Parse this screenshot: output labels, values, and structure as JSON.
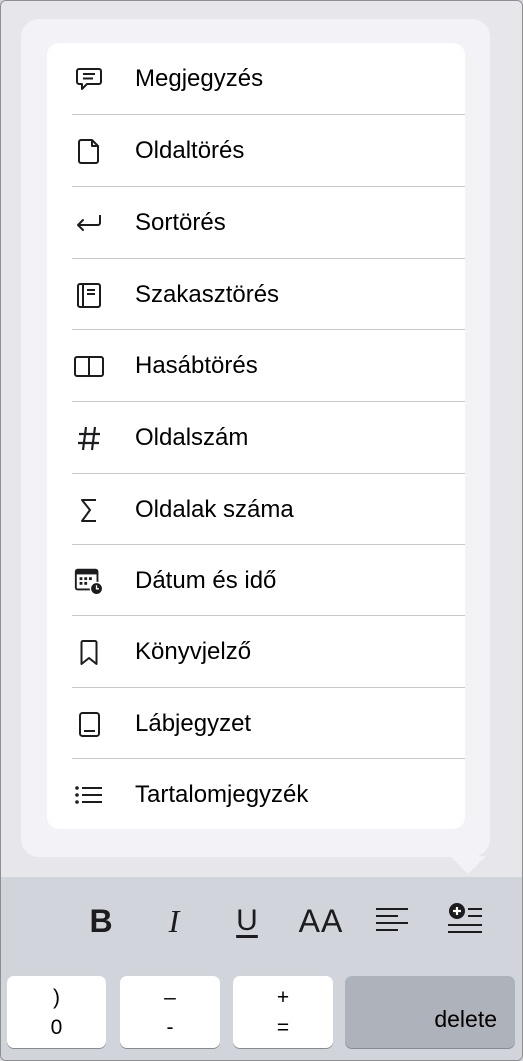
{
  "menu": {
    "items": [
      {
        "label": "Megjegyzés",
        "icon": "comment-icon"
      },
      {
        "label": "Oldaltörés",
        "icon": "page-break-icon"
      },
      {
        "label": "Sortörés",
        "icon": "line-break-icon"
      },
      {
        "label": "Szakasztörés",
        "icon": "section-break-icon"
      },
      {
        "label": "Hasábtörés",
        "icon": "column-break-icon"
      },
      {
        "label": "Oldalszám",
        "icon": "hash-icon"
      },
      {
        "label": "Oldalak száma",
        "icon": "sigma-icon"
      },
      {
        "label": "Dátum és idő",
        "icon": "calendar-clock-icon"
      },
      {
        "label": "Könyvjelző",
        "icon": "bookmark-icon"
      },
      {
        "label": "Lábjegyzet",
        "icon": "footnote-icon"
      },
      {
        "label": "Tartalomjegyzék",
        "icon": "list-icon"
      }
    ]
  },
  "toolbar": {
    "bold": "B",
    "italic": "I",
    "underline": "U",
    "font_size": "AA",
    "align": "align-left-icon",
    "insert": "insert-plus-icon"
  },
  "keyboard": {
    "key1": {
      "top": ")",
      "bottom": "0"
    },
    "key2": {
      "top": "–",
      "bottom": "-"
    },
    "key3": {
      "top": "+",
      "bottom": "="
    },
    "delete": "delete"
  }
}
